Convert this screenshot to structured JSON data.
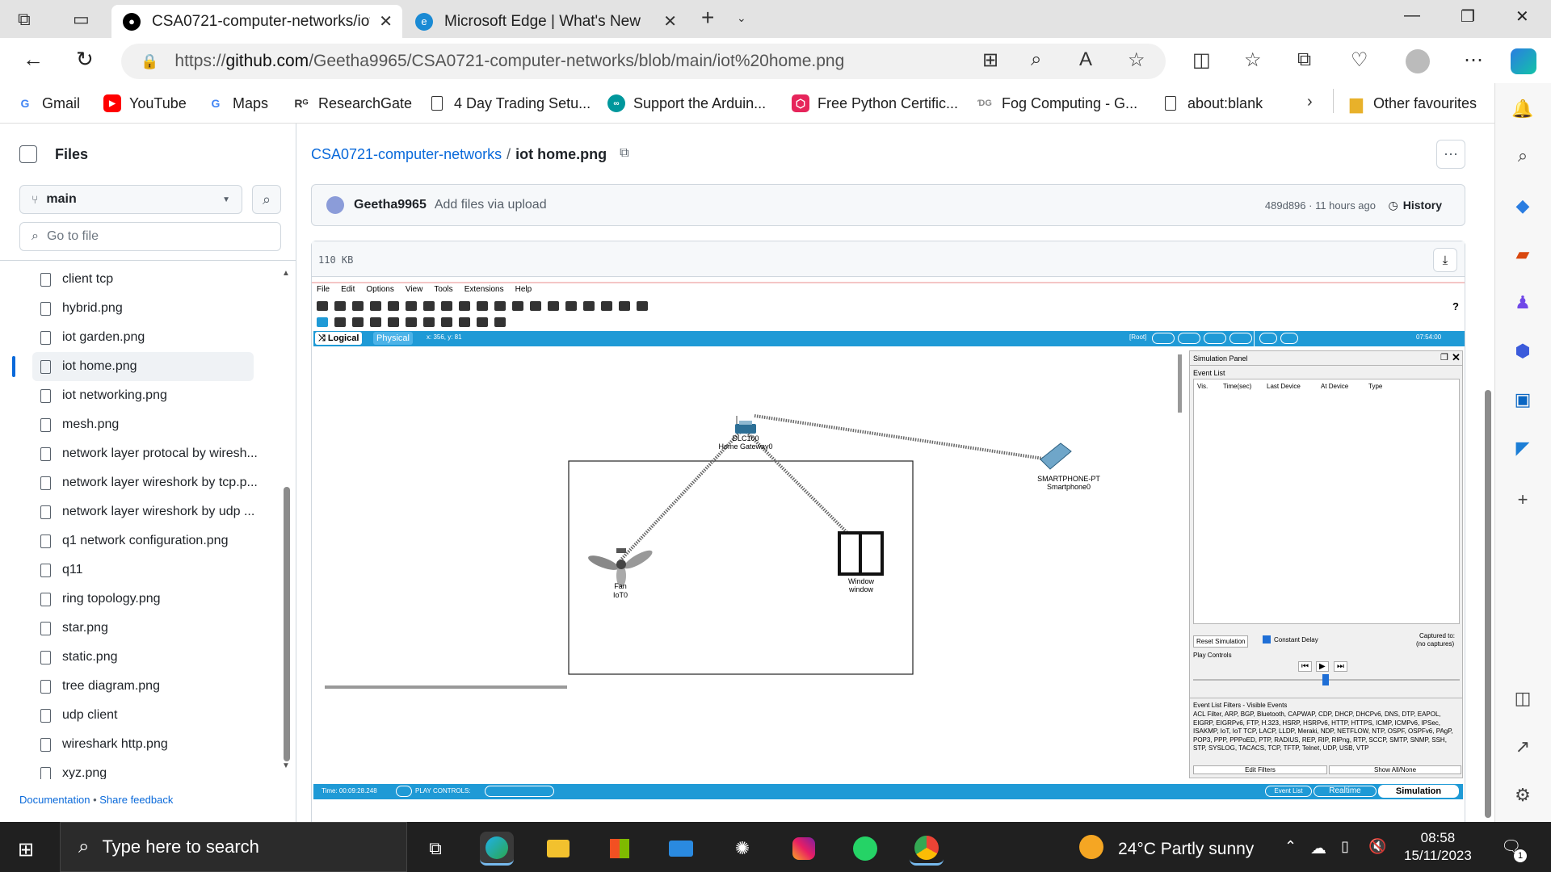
{
  "tabs": [
    {
      "title": "CSA0721-computer-networks/iot",
      "active": true
    },
    {
      "title": "Microsoft Edge | What's New",
      "active": false
    }
  ],
  "url": "https://github.com/Geetha9965/CSA0721-computer-networks/blob/main/iot%20home.png",
  "url_prefix": "https://",
  "url_host": "github.com",
  "url_path": "/Geetha9965/CSA0721-computer-networks/blob/main/iot%20home.png",
  "favorites": [
    {
      "label": "Gmail",
      "icon": "google-icon"
    },
    {
      "label": "YouTube",
      "icon": "youtube-icon"
    },
    {
      "label": "Maps",
      "icon": "google-icon"
    },
    {
      "label": "ResearchGate",
      "icon": "researchgate-icon"
    },
    {
      "label": "4 Day Trading Setu...",
      "icon": "document-icon"
    },
    {
      "label": "Support the Arduin...",
      "icon": "arduino-icon"
    },
    {
      "label": "Free Python Certific...",
      "icon": "certificate-icon"
    },
    {
      "label": "Fog Computing - G...",
      "icon": "dg-icon"
    },
    {
      "label": "about:blank",
      "icon": "document-icon"
    }
  ],
  "other_favourites": "Other favourites",
  "files_panel": {
    "title": "Files",
    "branch": "main",
    "goto_placeholder": "Go to file",
    "items": [
      "client tcp",
      "hybrid.png",
      "iot garden.png",
      "iot home.png",
      "iot networking.png",
      "mesh.png",
      "network layer protocal by wiresh...",
      "network layer wireshork by tcp.p...",
      "network layer wireshork by udp ...",
      "q1 network configuration.png",
      "q11",
      "ring topology.png",
      "star.png",
      "static.png",
      "tree diagram.png",
      "udp client",
      "wireshark http.png",
      "xyz.png"
    ],
    "selected": "iot home.png",
    "footer_doc": "Documentation",
    "footer_sep": "•",
    "footer_feedback": "Share feedback"
  },
  "breadcrumb": {
    "repo": "CSA0721-computer-networks",
    "sep": "/",
    "file": "iot home.png"
  },
  "commit": {
    "author": "Geetha9965",
    "message": "Add files via upload",
    "hash_time": "489d896 · 11 hours ago",
    "history": "History"
  },
  "file_size": "110 KB",
  "pt": {
    "menu": [
      "File",
      "Edit",
      "Options",
      "View",
      "Tools",
      "Extensions",
      "Help"
    ],
    "help_q": "?",
    "logical": "Logical",
    "physical": "Physical",
    "coords": "x: 356, y: 81",
    "root": "[Root]",
    "clock": "07:54:00",
    "devices": [
      {
        "name": "DLC100",
        "sub": "Home Gateway0"
      },
      {
        "name": "SMARTPHONE-PT",
        "sub": "Smartphone0"
      },
      {
        "name": "Fan",
        "sub": "IoT0"
      },
      {
        "name": "Window",
        "sub": "window"
      }
    ],
    "sim_panel": {
      "title": "Simulation Panel",
      "event_list": "Event List",
      "cols": [
        "Vis.",
        "Time(sec)",
        "Last Device",
        "At Device",
        "Type"
      ],
      "reset": "Reset Simulation",
      "constant_delay": "Constant Delay",
      "captured": "Captured to:",
      "no_captures": "(no captures)",
      "play_controls": "Play Controls",
      "filters_title": "Event List Filters - Visible Events",
      "filters": "ACL Filter, ARP, BGP, Bluetooth, CAPWAP, CDP, DHCP, DHCPv6, DNS, DTP, EAPOL, EIGRP, EIGRPv6, FTP, H.323, HSRP, HSRPv6, HTTP, HTTPS, ICMP, ICMPv6, IPSec, ISAKMP, IoT, IoT TCP, LACP, LLDP, Meraki, NDP, NETFLOW, NTP, OSPF, OSPFv6, PAgP, POP3, PPP, PPPoED, PTP, RADIUS, REP, RIP, RIPng, RTP, SCCP, SMTP, SNMP, SSH, STP, SYSLOG, TACACS, TCP, TFTP, Telnet, UDP, USB, VTP",
      "edit_filters": "Edit Filters",
      "show_all": "Show All/None"
    },
    "time": "Time: 00:09:28.248",
    "play_controls_bar": "PLAY CONTROLS:",
    "event_list_btn": "Event List",
    "realtime": "Realtime",
    "simulation": "Simulation"
  },
  "taskbar": {
    "search": "Type here to search",
    "weather": "24°C  Partly sunny",
    "time": "08:58",
    "date": "15/11/2023",
    "notif": "1"
  },
  "colors": {
    "pt_blue": "#1f9ad6",
    "github_blue": "#0969da",
    "selected_bar": "#0969da"
  }
}
